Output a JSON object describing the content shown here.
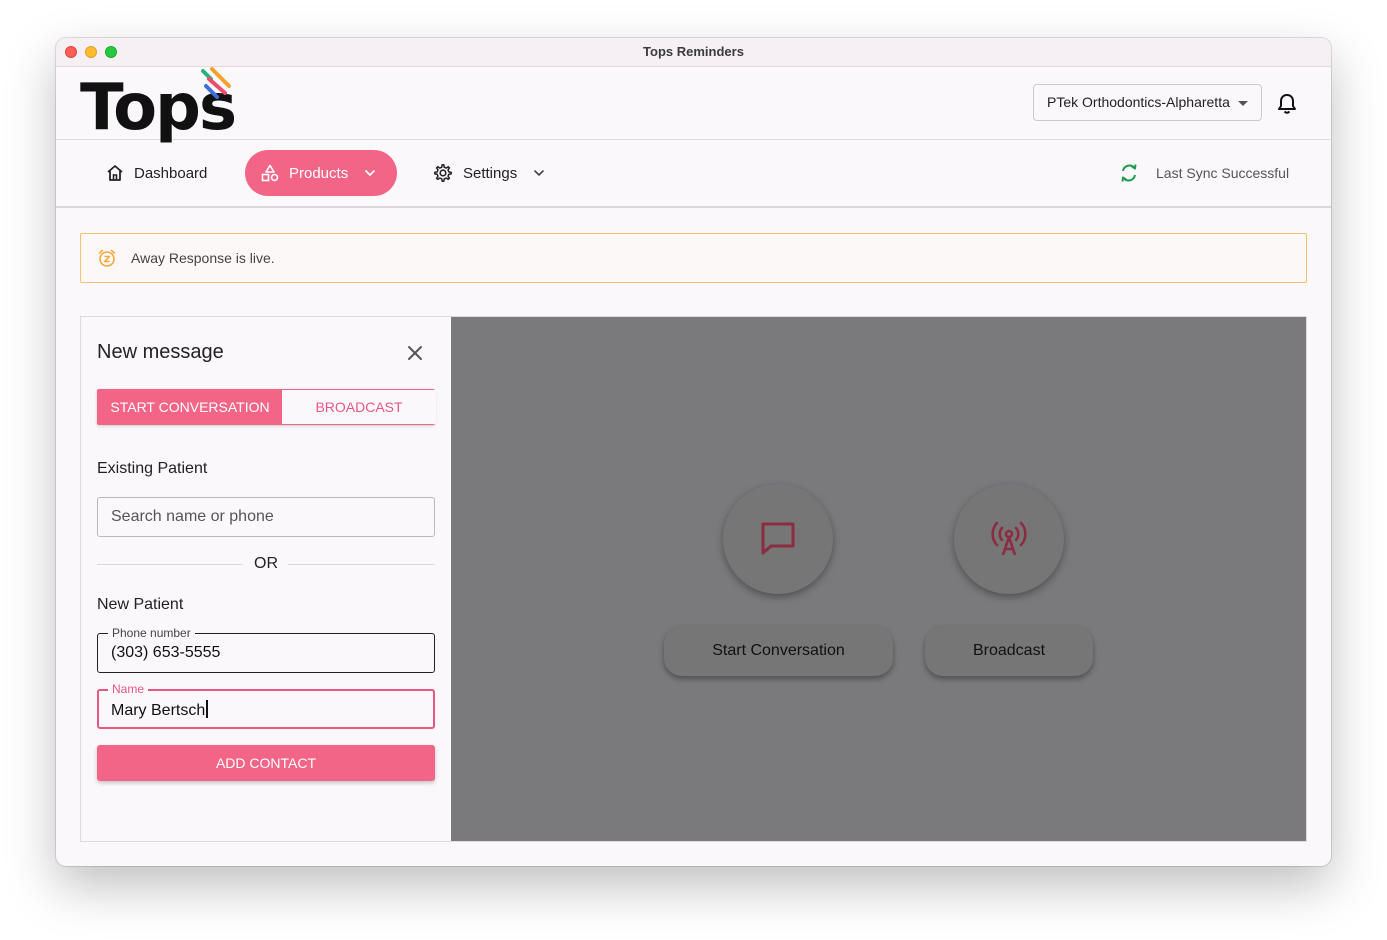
{
  "window": {
    "title": "Tops Reminders"
  },
  "header": {
    "logo_text": "Tops",
    "practice": "PTek Orthodontics-Alpharetta"
  },
  "nav": {
    "dashboard": "Dashboard",
    "products": "Products",
    "settings": "Settings",
    "sync_status": "Last Sync Successful"
  },
  "alert": {
    "text": "Away Response is live."
  },
  "new_message": {
    "title": "New message",
    "tabs": {
      "start": "START CONVERSATION",
      "broadcast": "BROADCAST",
      "active": "start"
    },
    "existing_label": "Existing Patient",
    "search_placeholder": "Search name or phone",
    "or_text": "OR",
    "new_label": "New Patient",
    "phone_label": "Phone number",
    "phone_value": "(303) 653-5555",
    "name_label": "Name",
    "name_value": "Mary Bertsch",
    "add_button": "ADD CONTACT"
  },
  "actions": {
    "start_label": "Start Conversation",
    "broadcast_label": "Broadcast"
  },
  "colors": {
    "accent": "#f26587",
    "overlay": "#7a7a7d",
    "alert_border": "#f2c36b",
    "sync_green": "#1e9b4b"
  },
  "icons": [
    "home-icon",
    "shapes-icon",
    "chevron-down-icon",
    "gear-icon",
    "sync-icon",
    "bell-icon",
    "alarm-icon",
    "close-icon",
    "chat-icon",
    "broadcast-icon"
  ]
}
